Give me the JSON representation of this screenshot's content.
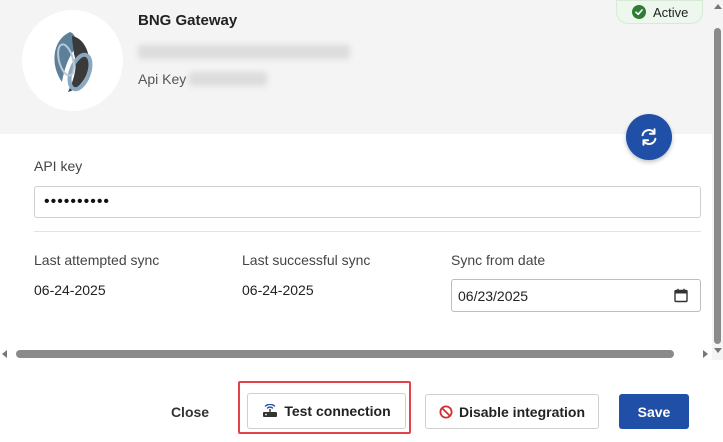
{
  "integration": {
    "name": "BNG Gateway",
    "api_key_label": "Api Key",
    "status": "Active"
  },
  "form": {
    "api_key_label": "API key",
    "api_key_value": "••••••••••",
    "last_attempted_label": "Last attempted sync",
    "last_attempted_value": "06-24-2025",
    "last_successful_label": "Last successful sync",
    "last_successful_value": "06-24-2025",
    "sync_from_label": "Sync from date",
    "sync_from_value": "06/23/2025"
  },
  "footer": {
    "close_label": "Close",
    "test_label": "Test connection",
    "disable_label": "Disable integration",
    "save_label": "Save"
  },
  "colors": {
    "primary": "#1f4fa6",
    "success": "#2e7d32",
    "highlight": "#e0444a",
    "danger": "#d32f2f"
  },
  "icons": {
    "refresh": "refresh-icon",
    "check": "check-circle-icon",
    "calendar": "calendar-icon",
    "router": "router-icon",
    "disable": "block-icon"
  }
}
